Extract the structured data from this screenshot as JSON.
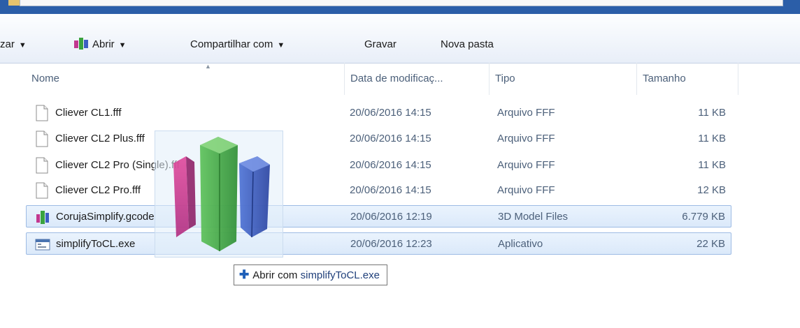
{
  "toolbar": {
    "organize_label": "zar",
    "open_label": "Abrir",
    "share_label": "Compartilhar com",
    "burn_label": "Gravar",
    "new_folder_label": "Nova pasta",
    "dropdown_arrow": "▼"
  },
  "columns": {
    "name": "Nome",
    "date": "Data de modificaç...",
    "type": "Tipo",
    "size": "Tamanho"
  },
  "files": [
    {
      "name": "Cliever CL1.fff",
      "date": "20/06/2016 14:15",
      "type": "Arquivo FFF",
      "size": "11 KB",
      "icon": "document-icon"
    },
    {
      "name": "Cliever CL2 Plus.fff",
      "date": "20/06/2016 14:15",
      "type": "Arquivo FFF",
      "size": "11 KB",
      "icon": "document-icon"
    },
    {
      "name": "Cliever CL2 Pro (Single).fff",
      "date": "20/06/2016 14:15",
      "type": "Arquivo FFF",
      "size": "11 KB",
      "icon": "document-icon"
    },
    {
      "name": "Cliever CL2 Pro.fff",
      "date": "20/06/2016 14:15",
      "type": "Arquivo FFF",
      "size": "12 KB",
      "icon": "document-icon"
    },
    {
      "name": "CorujaSimplify.gcode",
      "date": "20/06/2016 12:19",
      "type": "3D Model Files",
      "size": "6.779 KB",
      "icon": "simplify3d-icon"
    },
    {
      "name": "simplifyToCL.exe",
      "date": "20/06/2016 12:23",
      "type": "Aplicativo",
      "size": "22 KB",
      "icon": "exe-window-icon"
    }
  ],
  "drop_tooltip": {
    "prefix": "Abrir com",
    "app": "simplifyToCL.exe"
  },
  "colors": {
    "selection_fill": "#dbe9fa",
    "selection_border": "#9dbbe4",
    "metadata_text": "#4c607a",
    "title_bar": "#2b5ea8"
  }
}
